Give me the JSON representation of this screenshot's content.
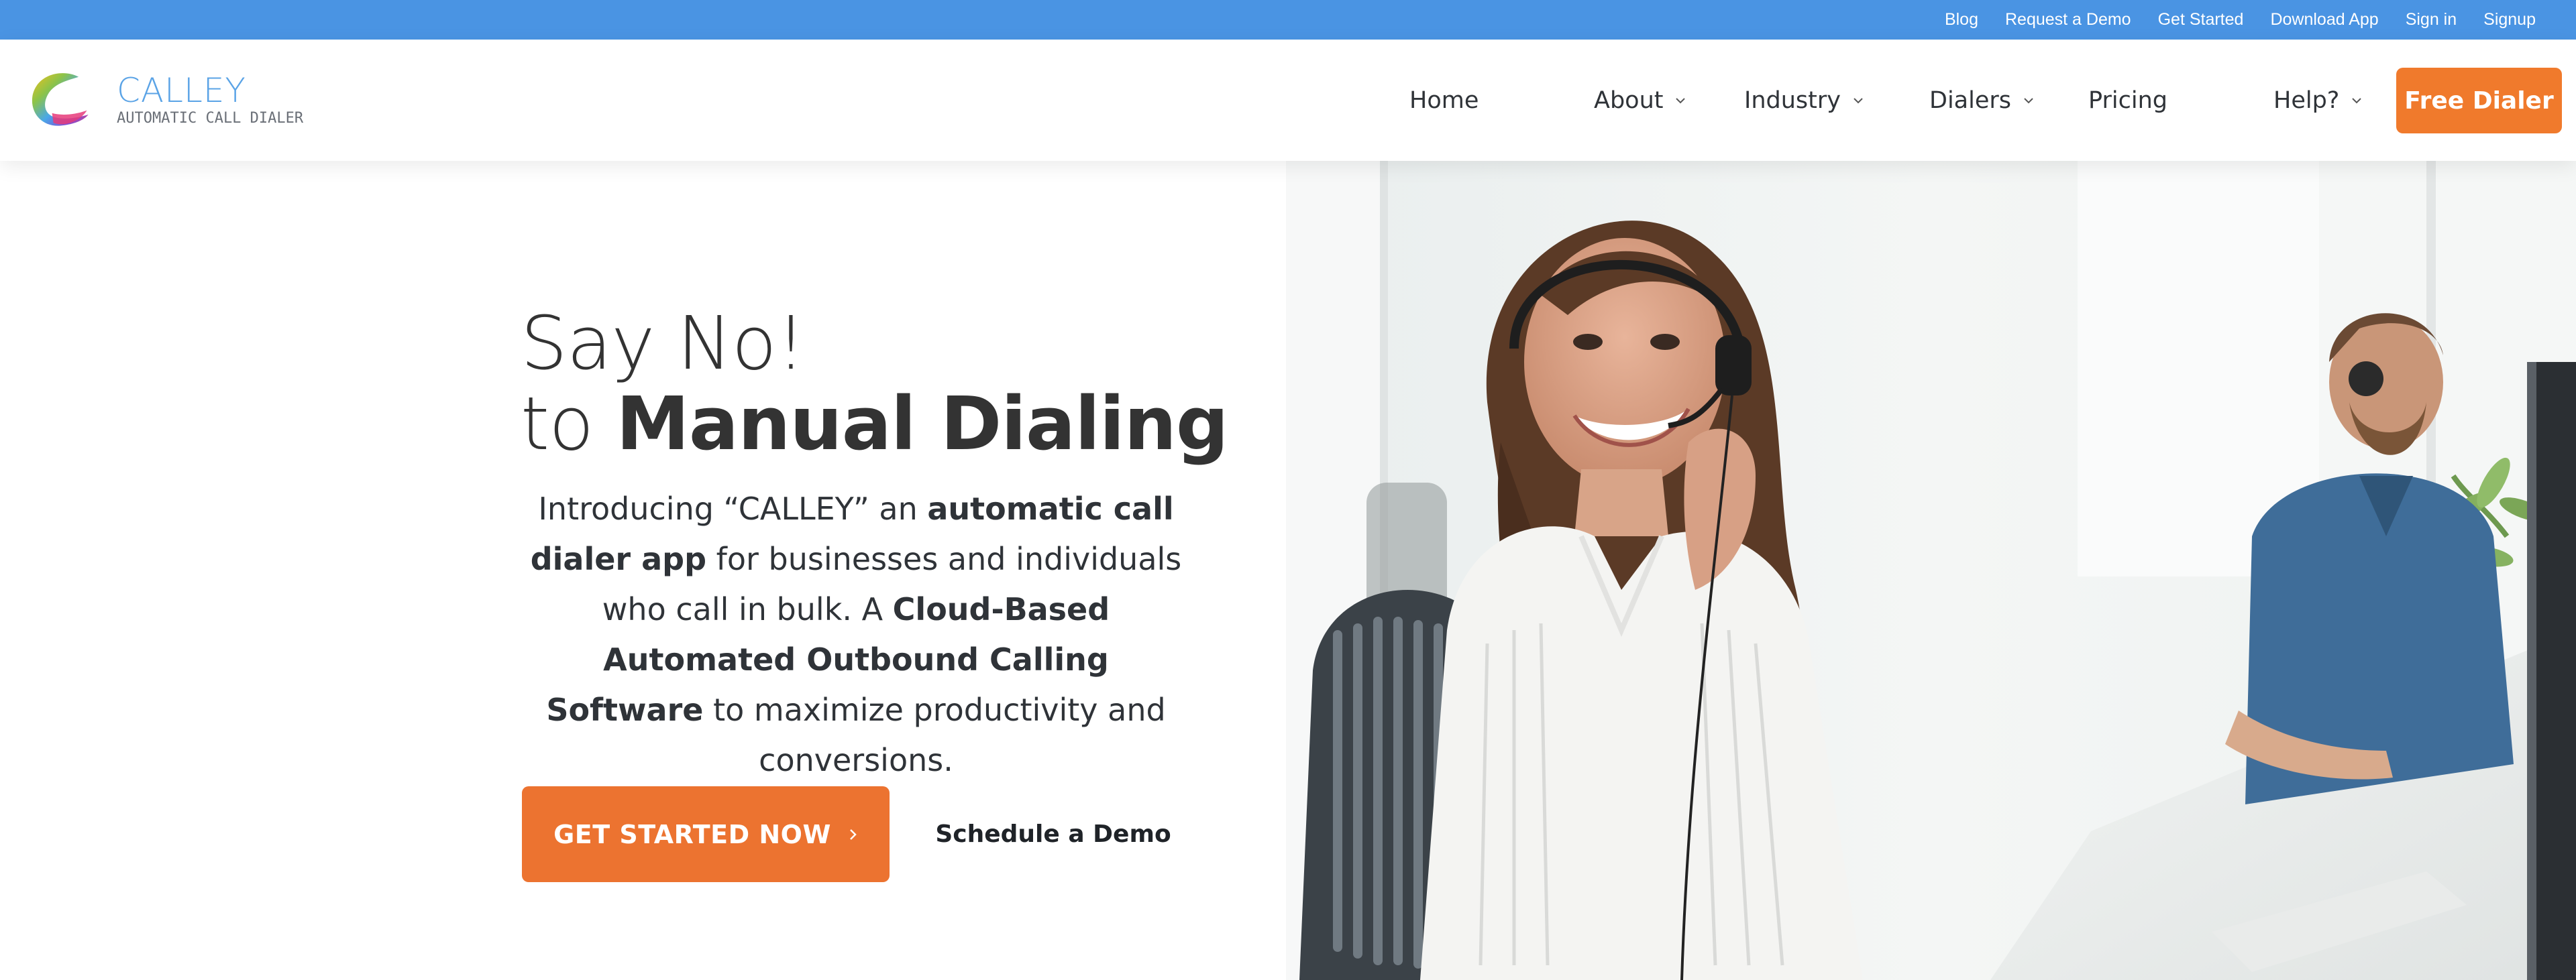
{
  "topbar": {
    "links": [
      {
        "label": "Blog"
      },
      {
        "label": "Request a Demo"
      },
      {
        "label": "Get Started"
      },
      {
        "label": "Download App"
      },
      {
        "label": "Sign in"
      },
      {
        "label": "Signup"
      }
    ]
  },
  "brand": {
    "name": "CALLEY",
    "tagline": "AUTOMATIC CALL DIALER"
  },
  "nav": {
    "items": [
      {
        "label": "Home",
        "has_dropdown": false
      },
      {
        "label": "About",
        "has_dropdown": true
      },
      {
        "label": "Industry",
        "has_dropdown": true
      },
      {
        "label": "Dialers",
        "has_dropdown": true
      },
      {
        "label": "Pricing",
        "has_dropdown": false
      },
      {
        "label": "Help?",
        "has_dropdown": true
      }
    ],
    "cta_label": "Free Dialer"
  },
  "hero": {
    "title_line1": "Say No!",
    "title_line2_prefix": "to ",
    "title_line2_bold": "Manual Dialing",
    "desc_part1": "Introducing “CALLEY” an ",
    "desc_bold1": "automatic call dialer app",
    "desc_part2": " for businesses and individuals who call in bulk. A ",
    "desc_bold2": "Cloud-Based Automated Outbound Calling Software",
    "desc_part3": " to maximize productivity and conversions.",
    "primary_cta": "GET STARTED NOW",
    "secondary_cta": "Schedule a Demo"
  },
  "colors": {
    "topbar": "#4a94e3",
    "accent_orange": "#ec7330",
    "text_dark": "#333333",
    "logo_blue": "#5aa3e6"
  },
  "icons": {
    "nav_dropdown": "chevron-down-icon",
    "cta_arrow": "chevron-right-icon",
    "logo": "calley-swirl-logo-icon"
  }
}
